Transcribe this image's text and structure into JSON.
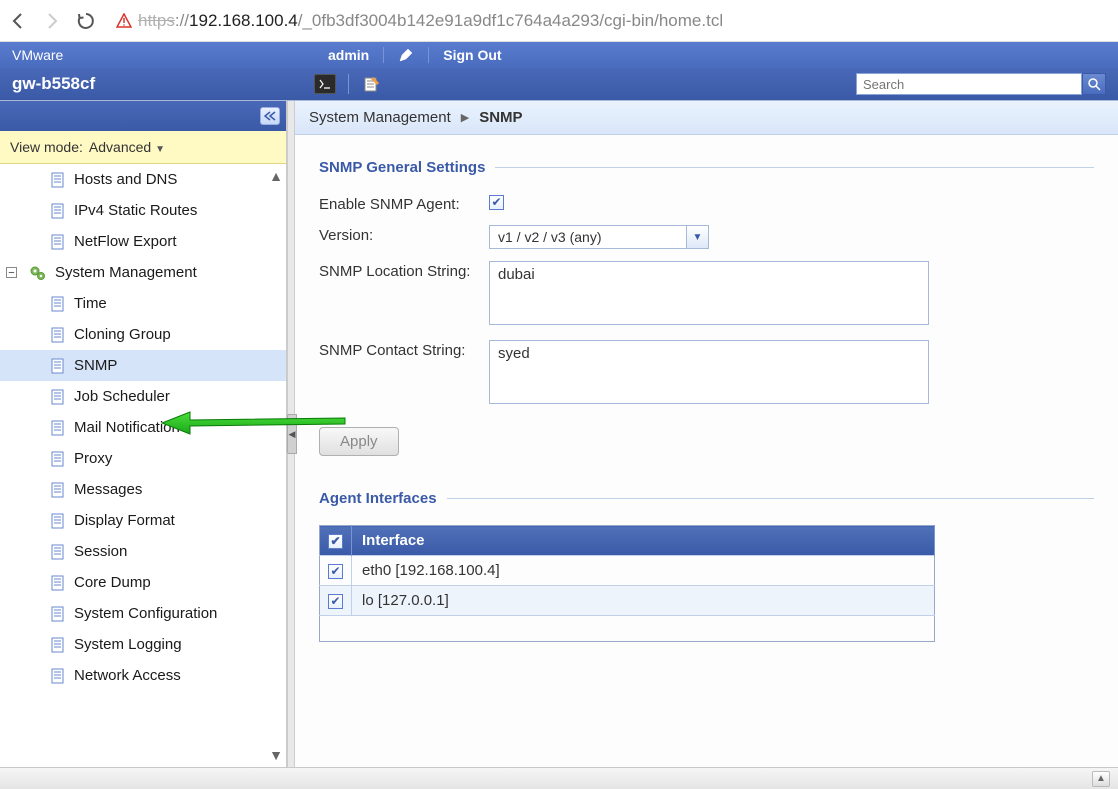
{
  "url": {
    "protocol_strike": "https",
    "sep": "://",
    "host": "192.168.100.4",
    "path": "/_0fb3df3004b142e91a9df1c764a4a293/cgi-bin/home.tcl"
  },
  "header": {
    "brand": "VMware",
    "user": "admin",
    "sign_out": "Sign Out",
    "device": "gw-b558cf",
    "search_placeholder": "Search"
  },
  "sidebar": {
    "view_mode_label": "View mode:",
    "view_mode_value": "Advanced",
    "items": [
      {
        "label": "Hosts and DNS",
        "type": "doc"
      },
      {
        "label": "IPv4 Static Routes",
        "type": "doc"
      },
      {
        "label": "NetFlow Export",
        "type": "doc"
      },
      {
        "label": "System Management",
        "type": "section"
      },
      {
        "label": "Time",
        "type": "doc"
      },
      {
        "label": "Cloning Group",
        "type": "doc"
      },
      {
        "label": "SNMP",
        "type": "doc",
        "selected": true
      },
      {
        "label": "Job Scheduler",
        "type": "doc"
      },
      {
        "label": "Mail Notification",
        "type": "doc"
      },
      {
        "label": "Proxy",
        "type": "doc"
      },
      {
        "label": "Messages",
        "type": "doc"
      },
      {
        "label": "Display Format",
        "type": "doc"
      },
      {
        "label": "Session",
        "type": "doc"
      },
      {
        "label": "Core Dump",
        "type": "doc"
      },
      {
        "label": "System Configuration",
        "type": "doc"
      },
      {
        "label": "System Logging",
        "type": "doc"
      },
      {
        "label": "Network Access",
        "type": "doc"
      }
    ]
  },
  "breadcrumb": {
    "parent": "System Management",
    "current": "SNMP"
  },
  "form": {
    "section1_title": "SNMP General Settings",
    "enable_label": "Enable SNMP Agent:",
    "enable_checked": true,
    "version_label": "Version:",
    "version_value": "v1 / v2 / v3 (any)",
    "location_label": "SNMP Location String:",
    "location_value": "dubai",
    "contact_label": "SNMP Contact String:",
    "contact_value": "syed",
    "apply_label": "Apply",
    "section2_title": "Agent Interfaces",
    "table": {
      "header_interface": "Interface",
      "rows": [
        {
          "label": "eth0 [192.168.100.4]",
          "checked": true
        },
        {
          "label": "lo [127.0.0.1]",
          "checked": true
        }
      ]
    }
  }
}
